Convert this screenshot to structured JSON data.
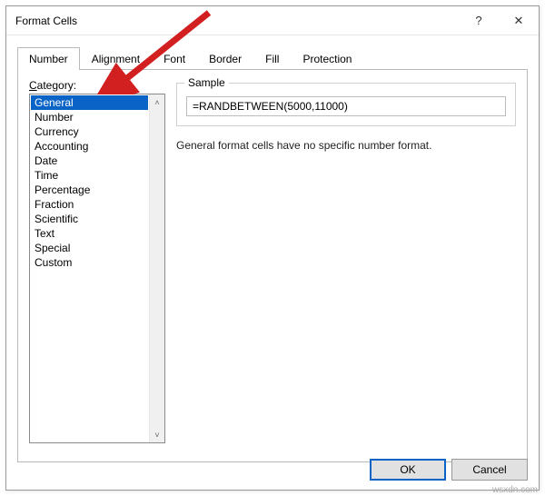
{
  "title": "Format Cells",
  "help_glyph": "?",
  "close_glyph": "✕",
  "tabs": [
    {
      "label": "Number"
    },
    {
      "label": "Alignment"
    },
    {
      "label": "Font"
    },
    {
      "label": "Border"
    },
    {
      "label": "Fill"
    },
    {
      "label": "Protection"
    }
  ],
  "category": {
    "prefix": "C",
    "suffix": "ategory:",
    "items": [
      "General",
      "Number",
      "Currency",
      "Accounting",
      "Date",
      "Time",
      "Percentage",
      "Fraction",
      "Scientific",
      "Text",
      "Special",
      "Custom"
    ]
  },
  "sample": {
    "legend": "Sample",
    "value": "=RANDBETWEEN(5000,11000)"
  },
  "description": "General format cells have no specific number format.",
  "buttons": {
    "ok": "OK",
    "cancel": "Cancel"
  },
  "watermark": "wsxdn.com",
  "scroll": {
    "up": "˄",
    "down": "˅"
  }
}
